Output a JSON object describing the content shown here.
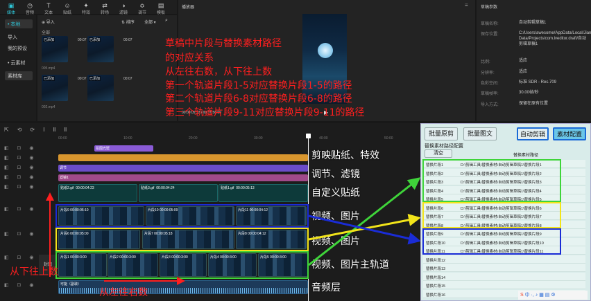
{
  "toolbar": {
    "tabs": [
      {
        "label": "媒体",
        "icon": "media-icon"
      },
      {
        "label": "音频",
        "icon": "audio-icon"
      },
      {
        "label": "文本",
        "icon": "text-icon"
      },
      {
        "label": "贴纸",
        "icon": "sticker-icon"
      },
      {
        "label": "特效",
        "icon": "effects-icon"
      },
      {
        "label": "转场",
        "icon": "transition-icon"
      },
      {
        "label": "滤镜",
        "icon": "filter-icon"
      },
      {
        "label": "调节",
        "icon": "adjust-icon"
      },
      {
        "label": "模板",
        "icon": "template-icon"
      }
    ]
  },
  "media": {
    "sidebar": [
      "• 本地",
      "导入",
      "我的预设",
      "• 云素材",
      "素材库"
    ],
    "import_label": "导入",
    "sort_label": "排序",
    "all_label": "全部",
    "section": "全部",
    "items": [
      {
        "tag": "已添加",
        "dur": "00:07",
        "name": "005.mp4"
      },
      {
        "tag": "已添加",
        "dur": "00:07",
        "name": ""
      },
      {
        "tag": "已添加",
        "dur": "00:07",
        "name": "002.mp4"
      },
      {
        "tag": "已添加",
        "dur": "00:07",
        "name": ""
      }
    ]
  },
  "player": {
    "title": "播放器",
    "time": "00:00:05:12 / 00:01:58:09"
  },
  "props": {
    "title": "草稿参数",
    "rows": [
      {
        "k": "草稿名称:",
        "v": "自动剪辑草稿1"
      },
      {
        "k": "保存位置:",
        "v": "C:/Users/awesome/AppData/Local/JianyingPro/User Data/Projects/com.lveditor.draft/自动剪辑草稿1"
      },
      {
        "k": "比例:",
        "v": "适应"
      },
      {
        "k": "分辨率:",
        "v": "适应"
      },
      {
        "k": "色彩空间:",
        "v": "标准 SDR - Rec.709"
      },
      {
        "k": "草稿帧率:",
        "v": "30.00帧/秒"
      },
      {
        "k": "导入方式:",
        "v": "保留在原有位置"
      }
    ]
  },
  "annot": {
    "top": [
      "草稿中片段与替换素材路径",
      "的对应关系",
      "从左往右数，从下往上数",
      "第一个轨道片段1-5对应替换片段1-5的路径",
      "第二个轨道片段6-8对应替换片段6-8的路径",
      "第三个轨道片段9-11对应替换片段9-11的路径"
    ],
    "tracks": [
      "剪映贴纸、特效",
      "调节、滤镜",
      "自定义贴纸",
      "视频、图片",
      "视频、图片",
      "视频、图片主轨道",
      "音频层"
    ],
    "bottom_up": "从下往上数",
    "left_right": "从左往右数"
  },
  "timeline": {
    "ruler": [
      "00:00",
      "10:00",
      "20:00",
      "30:00",
      "40:00",
      "50:00"
    ],
    "effect": "氛围光斑",
    "adjust": "调节",
    "filter": "滤镜1",
    "audio": "可能（副歌）",
    "cover": "封面",
    "stickers": [
      {
        "n": "贴纸2.gif",
        "d": "00:00:04:23"
      },
      {
        "n": "贴纸3.gif",
        "d": "00:00:04:24"
      },
      {
        "n": "贴纸1.gif",
        "d": "00:00:05:13"
      }
    ],
    "t3": [
      {
        "n": "片段9",
        "d": "00:00:05:10"
      },
      {
        "n": "片段10",
        "d": "00:00:05:09"
      },
      {
        "n": "片段11",
        "d": "00:00:04:12"
      }
    ],
    "t2": [
      {
        "n": "片段6",
        "d": "00:00:05:00"
      },
      {
        "n": "片段7",
        "d": "00:00:05:18"
      },
      {
        "n": "片段8",
        "d": "00:00:04:12"
      }
    ],
    "t1": [
      {
        "n": "片段1",
        "d": "00:00:3:00"
      },
      {
        "n": "片段2",
        "d": "00:00:3:00"
      },
      {
        "n": "片段3",
        "d": "00:00:3:00"
      },
      {
        "n": "片段4",
        "d": "00:00:3:00"
      },
      {
        "n": "片段5",
        "d": "00:00:3:00"
      }
    ]
  },
  "replace": {
    "btn1": "批量原剪",
    "btn2": "批量图文",
    "btn3": "自动剪辑",
    "btn4": "素材配置",
    "section": "替换素材路径配置",
    "clear": "清空",
    "col": "替换素材路径",
    "rows": [
      {
        "n": "替换片段1",
        "p": "D:\\剪辑工具\\替换素材\\自动剪辑草稿1\\替换片段1"
      },
      {
        "n": "替换片段2",
        "p": "D:\\剪辑工具\\替换素材\\自动剪辑草稿1\\替换片段2"
      },
      {
        "n": "替换片段3",
        "p": "D:\\剪辑工具\\替换素材\\自动剪辑草稿1\\替换片段3"
      },
      {
        "n": "替换片段4",
        "p": "D:\\剪辑工具\\替换素材\\自动剪辑草稿1\\替换片段4"
      },
      {
        "n": "替换片段5",
        "p": "D:\\剪辑工具\\替换素材\\自动剪辑草稿1\\替换片段5"
      },
      {
        "n": "替换片段6",
        "p": "D:\\剪辑工具\\替换素材\\自动剪辑草稿1\\替换片段6"
      },
      {
        "n": "替换片段7",
        "p": "D:\\剪辑工具\\替换素材\\自动剪辑草稿1\\替换片段7"
      },
      {
        "n": "替换片段8",
        "p": "D:\\剪辑工具\\替换素材\\自动剪辑草稿1\\替换片段8"
      },
      {
        "n": "替换片段9",
        "p": "D:\\剪辑工具\\替换素材\\自动剪辑草稿1\\替换片段9"
      },
      {
        "n": "替换片段10",
        "p": "D:\\剪辑工具\\替换素材\\自动剪辑草稿1\\替换片段10"
      },
      {
        "n": "替换片段11",
        "p": "D:\\剪辑工具\\替换素材\\自动剪辑草稿1\\替换片段11"
      },
      {
        "n": "替换片段12",
        "p": ""
      },
      {
        "n": "替换片段13",
        "p": ""
      },
      {
        "n": "替换片段14",
        "p": ""
      },
      {
        "n": "替换片段15",
        "p": ""
      },
      {
        "n": "替换片段16",
        "p": ""
      }
    ]
  },
  "colors": {
    "accent": "#2ec4d6",
    "green": "#3fd43a",
    "yellow": "#f2e41a",
    "blue": "#1a2cd6",
    "red": "#ff1f1f"
  }
}
